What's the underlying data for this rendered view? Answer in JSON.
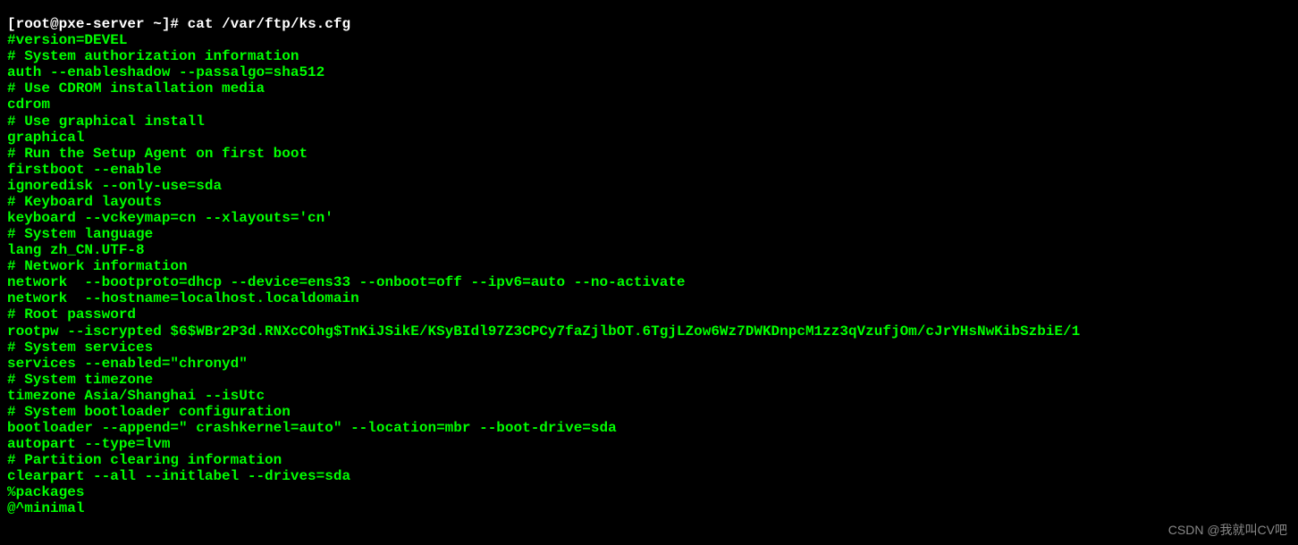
{
  "terminal": {
    "prompt": "[root@pxe-server ~]# ",
    "command": "cat /var/ftp/ks.cfg",
    "lines": [
      "#version=DEVEL",
      "# System authorization information",
      "auth --enableshadow --passalgo=sha512",
      "# Use CDROM installation media",
      "cdrom",
      "# Use graphical install",
      "graphical",
      "# Run the Setup Agent on first boot",
      "firstboot --enable",
      "ignoredisk --only-use=sda",
      "# Keyboard layouts",
      "keyboard --vckeymap=cn --xlayouts='cn'",
      "# System language",
      "lang zh_CN.UTF-8",
      "",
      "# Network information",
      "network  --bootproto=dhcp --device=ens33 --onboot=off --ipv6=auto --no-activate",
      "network  --hostname=localhost.localdomain",
      "",
      "# Root password",
      "rootpw --iscrypted $6$WBr2P3d.RNXcCOhg$TnKiJSikE/KSyBIdl97Z3CPCy7faZjlbOT.6TgjLZow6Wz7DWKDnpcM1zz3qVzufjOm/cJrYHsNwKibSzbiE/1",
      "# System services",
      "services --enabled=\"chronyd\"",
      "# System timezone",
      "timezone Asia/Shanghai --isUtc",
      "# System bootloader configuration",
      "bootloader --append=\" crashkernel=auto\" --location=mbr --boot-drive=sda",
      "autopart --type=lvm",
      "# Partition clearing information",
      "clearpart --all --initlabel --drives=sda",
      "",
      "%packages",
      "@^minimal"
    ]
  },
  "watermark": "CSDN @我就叫CV吧"
}
